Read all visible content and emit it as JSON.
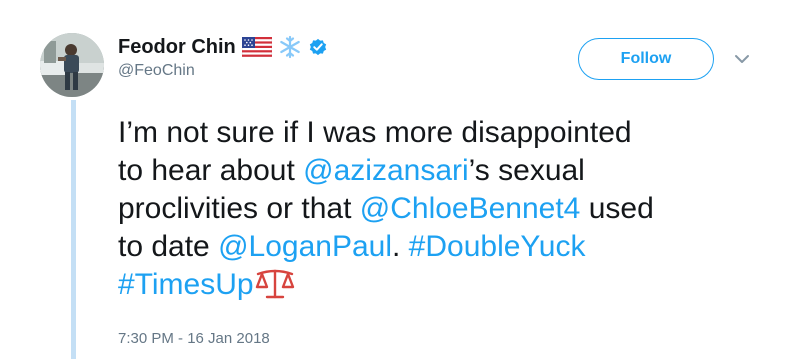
{
  "author": {
    "display_name": "Feodor Chin",
    "handle": "@FeoChin",
    "badges": [
      "us-flag-icon",
      "snowflake-icon",
      "verified-badge-icon"
    ]
  },
  "actions": {
    "follow_label": "Follow",
    "more_icon": "chevron-down-icon"
  },
  "tweet": {
    "t1": "I’m not sure if I was more disappointed",
    "t2": "to hear about ",
    "mention1": "@azizansari",
    "t3": "’s sexual",
    "t4": "proclivities or that ",
    "mention2": "@ChloeBennet4",
    "t5": " used",
    "t6": "to date ",
    "mention3": "@LoganPaul",
    "t7": ". ",
    "hashtag1": "#DoubleYuck",
    "hashtag2": "#TimesUp",
    "emoji": "scales-icon",
    "timestamp": "7:30 PM - 16 Jan 2018"
  },
  "colors": {
    "link": "#1da1f2",
    "text": "#14171a",
    "secondary": "#657786",
    "thread_line": "#c4dff5",
    "emoji": "#d7443e"
  }
}
